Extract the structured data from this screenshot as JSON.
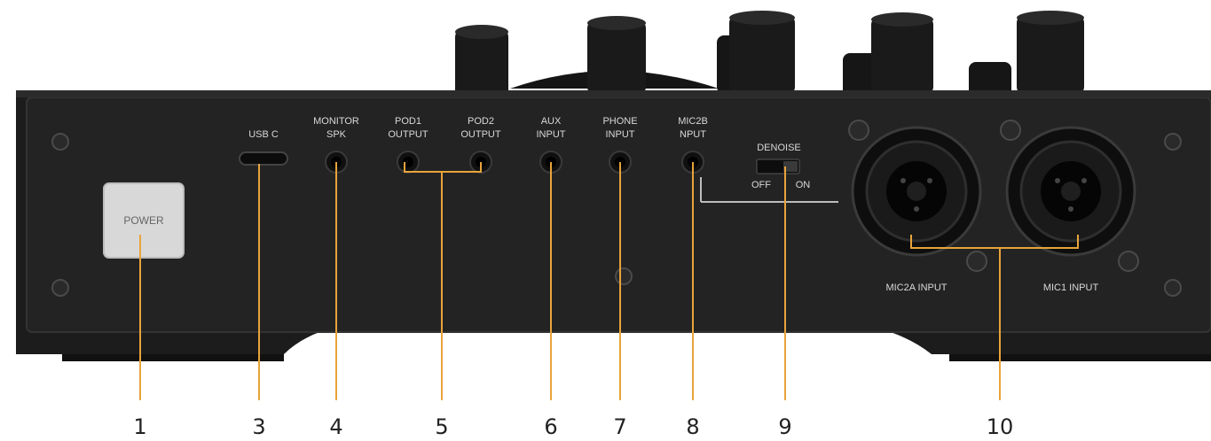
{
  "device": {
    "power_label": "POWER",
    "usb_label": "USB C",
    "monitor_label": [
      "MONITOR",
      "SPK"
    ],
    "pod1_label": [
      "POD1",
      "OUTPUT"
    ],
    "pod2_label": [
      "POD2",
      "OUTPUT"
    ],
    "aux_label": [
      "AUX",
      "INPUT"
    ],
    "phone_label": [
      "PHONE",
      "INPUT"
    ],
    "mic2b_label": [
      "MIC2B",
      "NPUT"
    ],
    "denoise_label": "DENOISE",
    "denoise_off": "OFF",
    "denoise_on": "ON",
    "mic2a_label": "MIC2A  INPUT",
    "mic1_label": "MIC1  INPUT"
  },
  "callouts": [
    "1",
    "3",
    "4",
    "5",
    "6",
    "7",
    "8",
    "9",
    "10"
  ],
  "colors": {
    "panel": "#1b1b1b",
    "leader": "#e8a43a",
    "power_button": "#d8d8d8"
  }
}
